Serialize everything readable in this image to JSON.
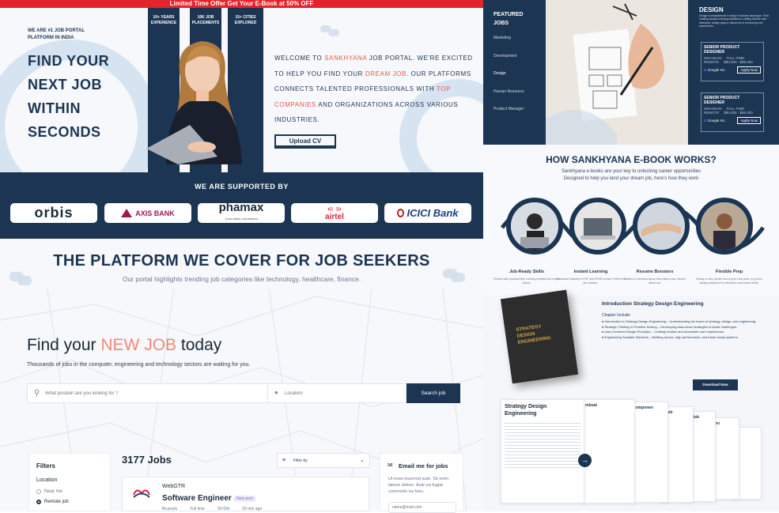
{
  "banner": {
    "text": "Limited Time Offer Get Your E-Book at 50% OFF"
  },
  "hero": {
    "tagline": "WE ARE #1 JOB PORTAL PLATFORM IN INDIA",
    "title": [
      "FIND YOUR",
      "NEXT JOB",
      "WITHIN",
      "SECONDS"
    ],
    "stats": [
      "10+ YEARS EXPERIENCE",
      "10K JOB PLACEMENTS",
      "15+ CITIES EXPLORED"
    ],
    "welcome_parts": [
      "WELCOME TO ",
      "SANKHYANA",
      " JOB PORTAL. WE'RE EXCITED TO HELP YOU FIND YOUR ",
      "DREAM JOB",
      ". OUR PLATFORMS CONNECTS TALENTED PROFESSIONALS WITH ",
      "TOP COMPANIES",
      " AND ORGANIZATIONS ACROSS VARIOUS INDUSTRIES."
    ],
    "upload": "Upload CV"
  },
  "supported": {
    "title": "WE ARE SUPPORTED BY",
    "logos": [
      "orbis",
      "AXIS BANK",
      "phamax",
      "airtel",
      "ICICI Bank"
    ],
    "phamax_sub": "YOUR VISION, OUR MISSION"
  },
  "featured": {
    "title": [
      "FEATURED",
      "JOBS"
    ],
    "items": [
      "Marketing",
      "Development",
      "Design",
      "Human Resource",
      "Product Manager"
    ]
  },
  "design": {
    "title": "DESIGN",
    "desc": "Design is characterized in today's business landscape. From creating visually stunning websites to crafting intuitive user interfaces, design plays a critical role in enhancing user experiences.",
    "cards": [
      {
        "title": "SENIOR PRODUCT DESIGNER",
        "loc": "MICHIGAN",
        "type": "FULL TIME",
        "remote": "REMOTE",
        "salary": "$80,000 - $95,000",
        "company": "Google Inc.",
        "apply": "Apply Now"
      },
      {
        "title": "SENIOR PRODUCT DESIGNER",
        "loc": "MICHIGAN",
        "type": "FULL TIME",
        "remote": "REMOTE",
        "salary": "$80,000 - $95,000",
        "company": "Google Inc.",
        "apply": "Apply Now"
      }
    ]
  },
  "ebook": {
    "title": "HOW SANKHYANA E-BOOK WORKS?",
    "sub": [
      "Sankhyana e-books are your key to unlocking career opportunities",
      "Designed to help you land your dream job, here's how they work"
    ],
    "steps": [
      {
        "label": "Job-Ready Skills",
        "desc": "Packed with practical tips, industry insights and expert advice."
      },
      {
        "label": "Instant Learning",
        "desc": "Download instantly in PDF and EPUB format. Perfect for job seekers."
      },
      {
        "label": "Resume Boosters",
        "desc": "Masters in-demand topics that makes your resume stand out."
      },
      {
        "label": "Flexible Prep",
        "desc": "Ready on any device and at your own pace, so you're always prepared for interviews and career shifts."
      }
    ],
    "book_cover": [
      "STRATEGY",
      "DESIGN",
      "ENGINEERING"
    ],
    "intro": "Introduction Strategy Design Engineering",
    "chapter": "Chapter Include:",
    "bullets": [
      "Introduction to Strategy Design Engineering – Understanding the fusion of strategy, design, and engineering.",
      "Strategic Thinking & Problem-Solving – Developing data-driven strategies to tackle challenges.",
      "User-Centered Design Principles – Crafting intuitive and accessible user experiences.",
      "Engineering Scalable Solutions – Building secure, high-performance, and future-ready systems."
    ],
    "download": "Download Now",
    "doc_title": "Strategy Design Engineering",
    "doc_heads": [
      "mbuat",
      "Komponen",
      "Web",
      "Untuk",
      "Men"
    ]
  },
  "platform": {
    "title": "THE PLATFORM WE COVER FOR JOB SEEKERS",
    "sub": "Our portal highlights trending job categories like technology, healthcare,  finance.",
    "find_parts": [
      "Find your ",
      "NEW JOB",
      " today"
    ],
    "find_sub": "Thousands of jobs in the computer, engineering and technology sectors are waiting for you.",
    "search_placeholder": "What position are you looking for ?",
    "location_placeholder": "Location",
    "search_btn": "Search job",
    "filters": {
      "title": "Filters",
      "location": "Location",
      "opts": [
        "Near me",
        "Remote job"
      ]
    },
    "jobs_count": "3177 Jobs",
    "filter_by": "Filter by",
    "job": {
      "company": "WebGTR",
      "title": "Software Engineer",
      "badge": "New post",
      "meta": [
        "Brussels",
        "Full time",
        "50-55k",
        "29 min ago"
      ]
    },
    "email": {
      "title": "Email me for jobs",
      "desc": "Ut esse eiusmod aute. Sit enim labore dolore. Aute ea fugiat commodo ea foes.",
      "placeholder": "name@mail.com"
    }
  },
  "colors": {
    "navy": "#1b3553",
    "accent": "#e8594a",
    "red_bar": "#e3242b"
  }
}
